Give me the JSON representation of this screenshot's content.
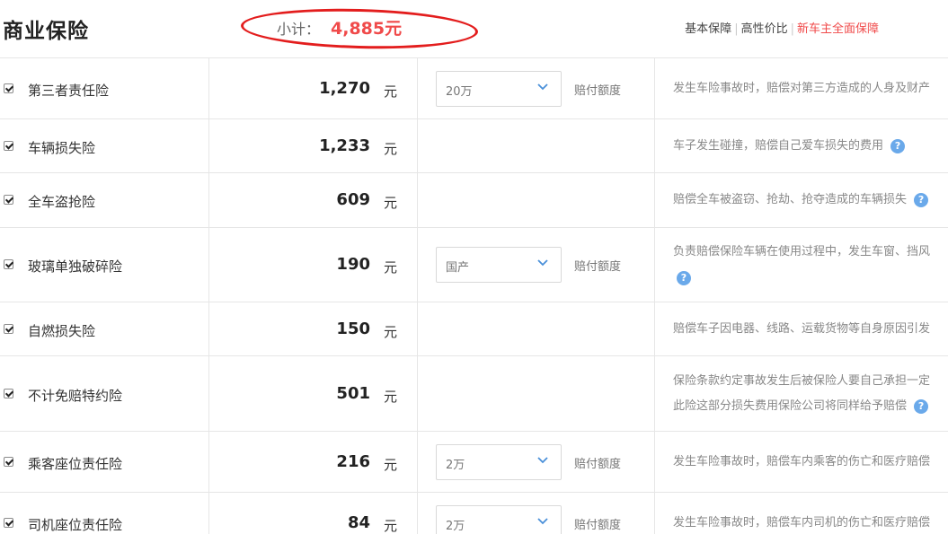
{
  "header": {
    "title": "商业保险",
    "subtotal_label": "小计：",
    "subtotal_value": "4,885元",
    "plans": [
      "基本保障",
      "高性价比",
      "新车主全面保障"
    ]
  },
  "rows": [
    {
      "checked": true,
      "name": "第三者责任险",
      "price": "1,270",
      "unit": "元",
      "select": "20万",
      "amount_label": "赔付额度",
      "desc": "发生车险事故时，赔偿对第三方造成的人身及财产"
    },
    {
      "checked": true,
      "name": "车辆损失险",
      "price": "1,233",
      "unit": "元",
      "desc": "车子发生碰撞，赔偿自己爱车损失的费用"
    },
    {
      "checked": true,
      "name": "全车盗抢险",
      "price": "609",
      "unit": "元",
      "desc": "赔偿全车被盗窃、抢劫、抢夺造成的车辆损失"
    },
    {
      "checked": true,
      "name": "玻璃单独破碎险",
      "price": "190",
      "unit": "元",
      "select": "国产",
      "amount_label": "赔付额度",
      "desc": "负责赔偿保险车辆在使用过程中，发生车窗、挡风"
    },
    {
      "checked": true,
      "name": "自燃损失险",
      "price": "150",
      "unit": "元",
      "desc": "赔偿车子因电器、线路、运载货物等自身原因引发"
    },
    {
      "checked": true,
      "name": "不计免赔特约险",
      "price": "501",
      "unit": "元",
      "desc": "保险条款约定事故发生后被保险人要自己承担一定",
      "desc2": "此险这部分损失费用保险公司将同样给予赔偿"
    },
    {
      "checked": true,
      "name": "乘客座位责任险",
      "price": "216",
      "unit": "元",
      "select": "2万",
      "amount_label": "赔付额度",
      "desc": "发生车险事故时，赔偿车内乘客的伤亡和医疗赔偿"
    },
    {
      "checked": true,
      "name": "司机座位责任险",
      "price": "84",
      "unit": "元",
      "select": "2万",
      "amount_label": "赔付额度",
      "desc": "发生车险事故时，赔偿车内司机的伤亡和医疗赔偿"
    }
  ],
  "help_glyph": "?",
  "colors": {
    "accent": "#f04a4a",
    "help": "#6aa9ea",
    "annotation": "#e31d1d"
  }
}
